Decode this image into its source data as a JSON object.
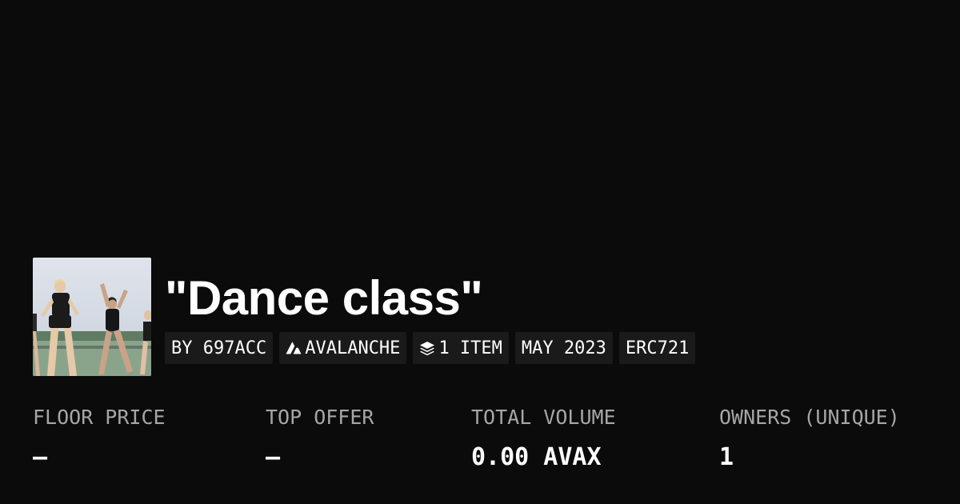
{
  "collection": {
    "title": "\"Dance class\"",
    "image_alt": "collection-thumbnail"
  },
  "tags": {
    "creator": "BY 697ACC",
    "chain": "AVALANCHE",
    "chain_icon": "avalanche-icon",
    "items": "1 ITEM",
    "items_icon": "layers-icon",
    "date": "MAY 2023",
    "standard": "ERC721"
  },
  "stats": {
    "floor_price": {
      "label": "FLOOR PRICE",
      "value": "–"
    },
    "top_offer": {
      "label": "TOP OFFER",
      "value": "–"
    },
    "total_volume": {
      "label": "TOTAL VOLUME",
      "value": "0.00 AVAX"
    },
    "owners": {
      "label": "OWNERS (UNIQUE)",
      "value": "1"
    }
  },
  "colors": {
    "background": "#0b0b0b",
    "tag_background": "#1a1a1a",
    "label": "#a6a6a6",
    "text": "#ffffff"
  }
}
